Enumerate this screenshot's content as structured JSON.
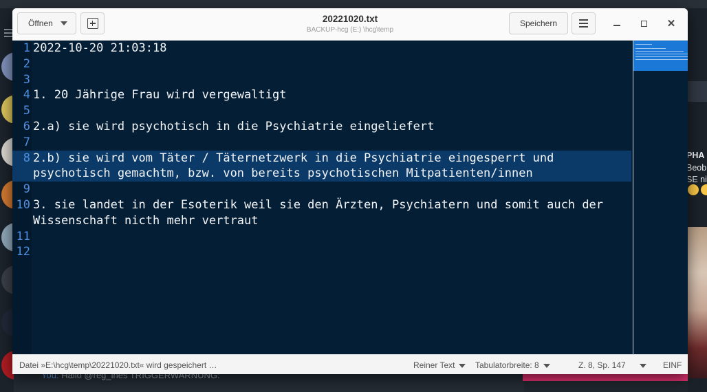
{
  "background": {
    "message_sender": "You:",
    "message_preview": "Hallo @reg_ines  TRIGGERWARNUNG:",
    "right_lines": [
      "PHA",
      "Beob",
      "SE ni"
    ],
    "accent": "#e0306e"
  },
  "header": {
    "open_label": "Öffnen",
    "save_label": "Speichern",
    "title": "20221020.txt",
    "subtitle": "BACKUP-hcg (E:) \\hcg\\temp"
  },
  "editor": {
    "lines": [
      {
        "num": "1",
        "text": "2022-10-20 21:03:18"
      },
      {
        "num": "2",
        "text": ""
      },
      {
        "num": "3",
        "text": ""
      },
      {
        "num": "4",
        "text": "1. 20 Jährige Frau wird vergewaltigt"
      },
      {
        "num": "5",
        "text": ""
      },
      {
        "num": "6",
        "text": "2.a) sie wird psychotisch in die Psychiatrie eingeliefert"
      },
      {
        "num": "7",
        "text": ""
      },
      {
        "num": "8",
        "text": "2.b) sie wird vom Täter / Täternetzwerk in die Psychiatrie eingesperrt und psychotisch gemachtm, bzw. von bereits psychotischen Mitpatienten/innen"
      },
      {
        "num": "9",
        "text": ""
      },
      {
        "num": "10",
        "text": "3. sie landet in der Esoterik weil sie den Ärzten, Psychiatern und somit auch der Wissenschaft nicth mehr vertraut"
      },
      {
        "num": "11",
        "text": ""
      },
      {
        "num": "12",
        "text": ""
      }
    ],
    "highlight_color": "#0b3a69",
    "background_color": "#041e36"
  },
  "status": {
    "message": "Datei »E:\\hcg\\temp\\20221020.txt« wird gespeichert …",
    "language": "Reiner Text",
    "tab_width": "Tabulatorbreite: 8",
    "position": "Z. 8, Sp. 147",
    "insert_mode": "EINF"
  }
}
